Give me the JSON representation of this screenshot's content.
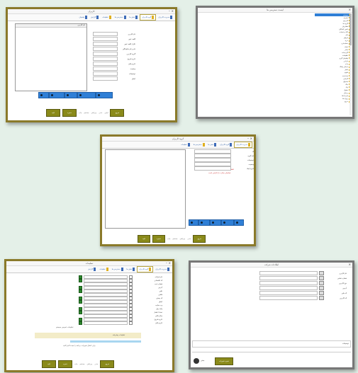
{
  "window_a": {
    "title": "کاربران",
    "close": "×",
    "tabs": [
      {
        "label": "مدیریت کاربران"
      },
      {
        "label": "گروه کاربران"
      },
      {
        "label": "نقش ها"
      },
      {
        "label": "دسترسی ها"
      },
      {
        "label": "تنظیمات"
      },
      {
        "label": "گزارش"
      },
      {
        "label": "پشتیبان"
      }
    ],
    "list_header": "نام کاربری",
    "fields": [
      {
        "label": "نام کاربری"
      },
      {
        "label": "کلمه عبور"
      },
      {
        "label": "تکرار کلمه عبور"
      },
      {
        "label": "نام و نام خانوادگی"
      },
      {
        "label": "گروه کاربری"
      },
      {
        "label": "تاریخ شروع"
      },
      {
        "label": "تاریخ پایان"
      },
      {
        "label": "وضعیت"
      },
      {
        "label": "توضیحات"
      },
      {
        "label": "ایمیل"
      }
    ],
    "buttons": [
      "جدید",
      "ویرایش",
      "حذف",
      "ذخیره",
      "انصراف"
    ],
    "toolbar": {
      "confirm": "تایید",
      "save": "ذخیره",
      "items": [
        "چاپ",
        "جستجو",
        "ویرایش",
        "حذف",
        "اولین"
      ],
      "exit": "خروج"
    }
  },
  "window_b": {
    "title": "لیست دسترسی ها",
    "tree_items": [
      "سیستم",
      "تعاریف",
      "کاربران",
      "گروه ها",
      "مشتریان",
      "تامین کنندگان",
      "کالا و خدمات",
      "انبار",
      "فروش",
      "خرید",
      "حسابداری",
      "اسناد",
      "دفاتر",
      "گزارشات",
      "تنظیمات",
      "پشتیبان گیری",
      "بازیابی",
      "چاپ",
      "ارسال پیامک",
      "ایمیل",
      "تقویم",
      "یادداشت",
      "کارتابل",
      "صندوق",
      "بانک",
      "چک",
      "حقوق",
      "پرسنل",
      "قراردادها",
      "پروژه ها",
      "خروج"
    ]
  },
  "window_c": {
    "title": "گروه کاربران",
    "fields": [
      {
        "label": "کد"
      },
      {
        "label": "نام گروه"
      },
      {
        "label": "توضیحات"
      },
      {
        "label": "وضعیت"
      },
      {
        "label": "تاریخ ایجاد"
      }
    ],
    "red_line_1": "لطفا اطلاعات را وارد کنید",
    "red_line_2": "فیلدهای ستاره دار الزامی است",
    "buttons": [
      "جدید",
      "ویرایش",
      "حذف",
      "ذخیره",
      "انصراف"
    ],
    "toolbar": {
      "confirm": "تایید",
      "save": "ذخیره",
      "exit": "خروج"
    }
  },
  "window_d": {
    "title": "تنظیمات",
    "settings_rows": [
      "نام شرکت",
      "کد اقتصادی",
      "شماره ثبت",
      "آدرس",
      "تلفن",
      "فکس",
      "کد پستی",
      "ایمیل",
      "وب سایت",
      "واحد پول",
      "تعداد اعشار",
      "سال مالی",
      "تاریخ شروع",
      "تاریخ پایان"
    ],
    "note_1": "تنظیمات عمومی سیستم",
    "note_2": "برای اعمال تغییرات، برنامه را مجددا اجرا کنید",
    "note_3": "تنظیمات پیشرفته",
    "toolbar": {
      "confirm": "تایید",
      "save": "ذخیره",
      "exit": "خروج"
    }
  },
  "window_e": {
    "title": "اطلاعات شرکت",
    "fields": [
      {
        "label": "نام کاربری"
      },
      {
        "label": "شماره تماس"
      },
      {
        "label": "نوع کاربری"
      },
      {
        "label": "آدرس"
      },
      {
        "label": "کد ملی"
      },
      {
        "label": "کد کاربری"
      }
    ],
    "desc_label": "توضیحات",
    "btn_save": "ذخیره تغییرات",
    "btn_close": "بستن"
  },
  "colors": {
    "frame": "#8a7a2a",
    "accent_blue": "#2f7fd6",
    "olive": "#8a8a1a",
    "tab_icon": "#3d6bb8",
    "highlight": "#e0b020",
    "red_text": "#c33333"
  }
}
